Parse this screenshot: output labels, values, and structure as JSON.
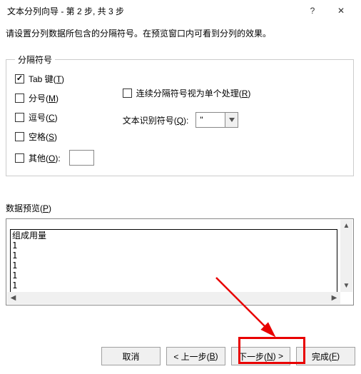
{
  "titlebar": {
    "title": "文本分列向导 - 第 2 步, 共 3 步"
  },
  "instruction": "请设置分列数据所包含的分隔符号。在预览窗口内可看到分列的效果。",
  "group": {
    "legend": "分隔符号"
  },
  "delimiters": {
    "tab": {
      "pre": "Tab 键(",
      "key": "T",
      "post": ")",
      "checked": true
    },
    "semi": {
      "pre": "分号(",
      "key": "M",
      "post": ")",
      "checked": false
    },
    "comma": {
      "pre": "逗号(",
      "key": "C",
      "post": ")",
      "checked": false
    },
    "space": {
      "pre": "空格(",
      "key": "S",
      "post": ")",
      "checked": false
    },
    "other": {
      "pre": "其他(",
      "key": "O",
      "post": "):",
      "checked": false,
      "value": ""
    }
  },
  "consecutive": {
    "pre": "连续分隔符号视为单个处理(",
    "key": "R",
    "post": ")",
    "checked": false
  },
  "qualifier": {
    "pre": "文本识别符号(",
    "key": "Q",
    "post": "):",
    "value": "\""
  },
  "preview": {
    "label_pre": "数据预览(",
    "label_key": "P",
    "label_post": ")",
    "lines": [
      "组成用量",
      "1",
      "1",
      "1",
      "1",
      "1"
    ]
  },
  "buttons": {
    "cancel": "取消",
    "back": {
      "pre": "< 上一步(",
      "key": "B",
      "post": ")"
    },
    "next": {
      "pre": "下一步(",
      "key": "N",
      "post": ") >"
    },
    "finish": {
      "pre": "完成(",
      "key": "F",
      "post": ")"
    }
  }
}
